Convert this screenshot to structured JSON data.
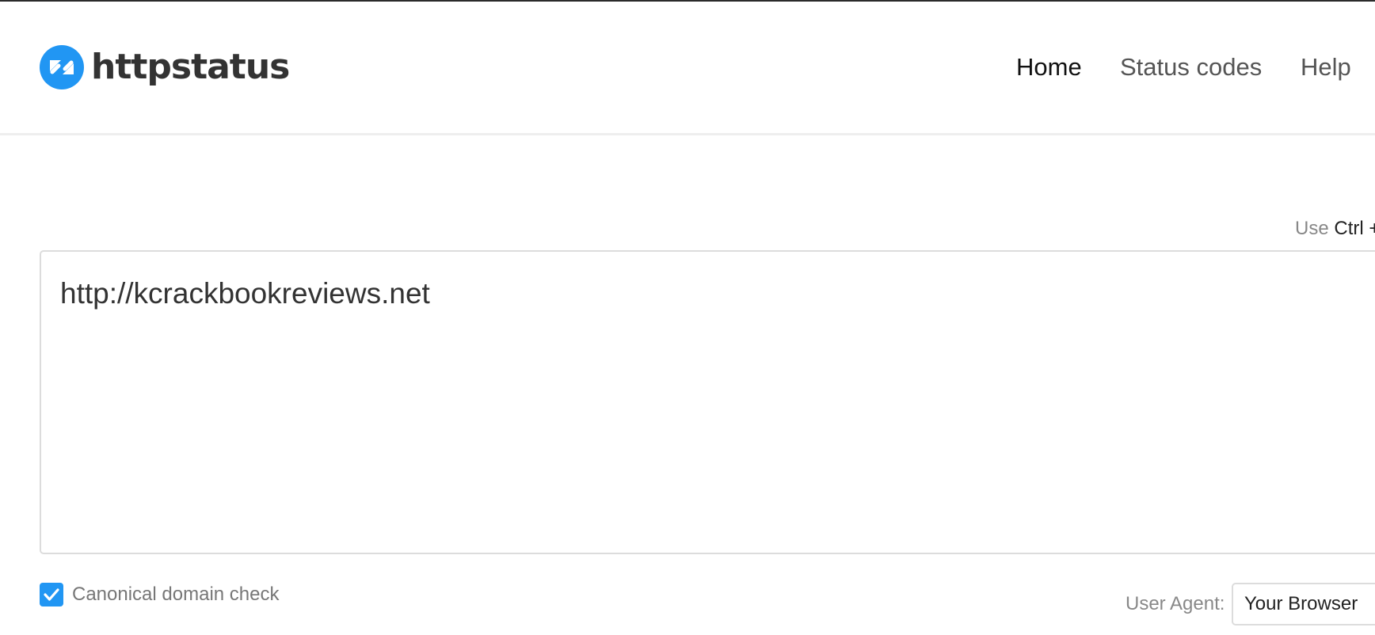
{
  "app": {
    "name": "httpstatus",
    "brand_color": "#2196f3"
  },
  "nav": {
    "items": [
      {
        "label": "Home",
        "active": true
      },
      {
        "label": "Status codes",
        "active": false
      },
      {
        "label": "Help",
        "active": false
      }
    ]
  },
  "hint": {
    "prefix": "Use",
    "key": "Ctrl +"
  },
  "url_input": {
    "value": "http://kcrackbookreviews.net"
  },
  "options": {
    "canonical_check": {
      "label": "Canonical domain check",
      "checked": true
    },
    "user_agent": {
      "label": "User Agent:",
      "selected": "Your Browser"
    }
  },
  "icons": {
    "logo": "arrows-in-circle-icon",
    "checkbox": "checkmark-icon"
  }
}
